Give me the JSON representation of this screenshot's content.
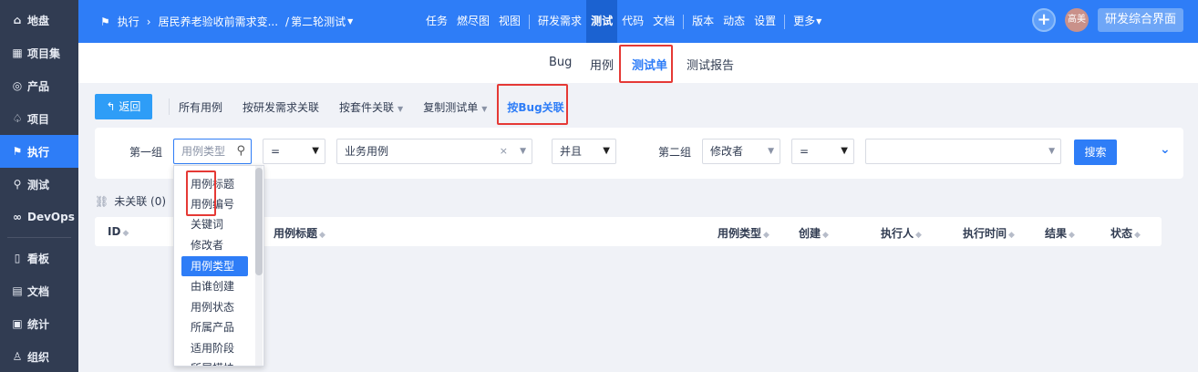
{
  "sidebar": {
    "items": [
      {
        "icon": "home-icon",
        "glyph": "⌂",
        "label": "地盘"
      },
      {
        "icon": "grid-icon",
        "glyph": "▦",
        "label": "项目集"
      },
      {
        "icon": "lightbulb-icon",
        "glyph": "◎",
        "label": "产品"
      },
      {
        "icon": "rocket-icon",
        "glyph": "♤",
        "label": "项目"
      },
      {
        "icon": "run-icon",
        "glyph": "⚑",
        "label": "执行"
      },
      {
        "icon": "search-icon",
        "glyph": "⚲",
        "label": "测试"
      },
      {
        "icon": "infinity-icon",
        "glyph": "∞",
        "label": "DevOps"
      },
      {
        "icon": "kanban-icon",
        "glyph": "▯",
        "label": "看板"
      },
      {
        "icon": "doc-icon",
        "glyph": "▤",
        "label": "文档"
      },
      {
        "icon": "chart-icon",
        "glyph": "▣",
        "label": "统计"
      },
      {
        "icon": "people-icon",
        "glyph": "♙",
        "label": "组织"
      }
    ],
    "active_index": 4
  },
  "topbar": {
    "exec_label": "执行",
    "project": "居民养老验收前需求变...",
    "round": "第二轮测试",
    "nav": [
      "任务",
      "燃尽图",
      "视图",
      "研发需求",
      "测试",
      "代码",
      "文档",
      "版本",
      "动态",
      "设置",
      "更多"
    ],
    "avatar": "高美",
    "switch_label": "研发综合界面"
  },
  "subtabs": [
    "Bug",
    "用例",
    "测试单",
    "测试报告"
  ],
  "featurebar": {
    "back": "返回",
    "items": [
      "所有用例",
      "按研发需求关联",
      "按套件关联",
      "复制测试单",
      "按Bug关联"
    ]
  },
  "search": {
    "group1_label": "第一组",
    "field1_placeholder": "用例类型",
    "op1": "=",
    "value1": "业务用例",
    "logic": "并且",
    "group2_label": "第二组",
    "field2": "修改者",
    "op2": "=",
    "value2": "",
    "button": "搜索"
  },
  "unlinked": "未关联 (0)",
  "table": {
    "columns": [
      "ID",
      "用例标题",
      "用例类型",
      "创建",
      "执行人",
      "执行时间",
      "结果",
      "状态"
    ]
  },
  "dropdown": {
    "options": [
      "用例标题",
      "用例编号",
      "关键词",
      "修改者",
      "用例类型",
      "由谁创建",
      "用例状态",
      "所属产品",
      "适用阶段",
      "所属模块"
    ],
    "selected": "用例类型"
  }
}
